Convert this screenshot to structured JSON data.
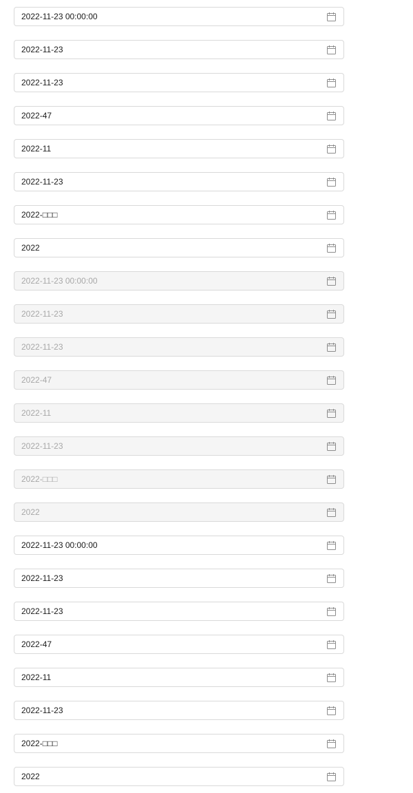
{
  "colors": {
    "border": "#d9d9d9",
    "text": "#1a1a1a",
    "disabled_text": "#a8a8a8",
    "disabled_bg": "#f5f5f5",
    "icon": "#8c8c8c"
  },
  "icon": "calendar-icon",
  "groups": [
    {
      "state": "enabled",
      "fields": [
        {
          "value": "2022-11-23 00:00:00"
        },
        {
          "value": "2022-11-23"
        },
        {
          "value": "2022-11-23"
        },
        {
          "value": "2022-47"
        },
        {
          "value": "2022-11"
        },
        {
          "value": "2022-11-23"
        },
        {
          "value": "2022-□□□"
        },
        {
          "value": "2022"
        }
      ]
    },
    {
      "state": "disabled",
      "fields": [
        {
          "value": "2022-11-23 00:00:00"
        },
        {
          "value": "2022-11-23"
        },
        {
          "value": "2022-11-23"
        },
        {
          "value": "2022-47"
        },
        {
          "value": "2022-11"
        },
        {
          "value": "2022-11-23"
        },
        {
          "value": "2022-□□□"
        },
        {
          "value": "2022"
        }
      ]
    },
    {
      "state": "enabled",
      "fields": [
        {
          "value": "2022-11-23 00:00:00"
        },
        {
          "value": "2022-11-23"
        },
        {
          "value": "2022-11-23"
        },
        {
          "value": "2022-47"
        },
        {
          "value": "2022-11"
        },
        {
          "value": "2022-11-23"
        },
        {
          "value": "2022-□□□"
        },
        {
          "value": "2022"
        }
      ]
    }
  ]
}
